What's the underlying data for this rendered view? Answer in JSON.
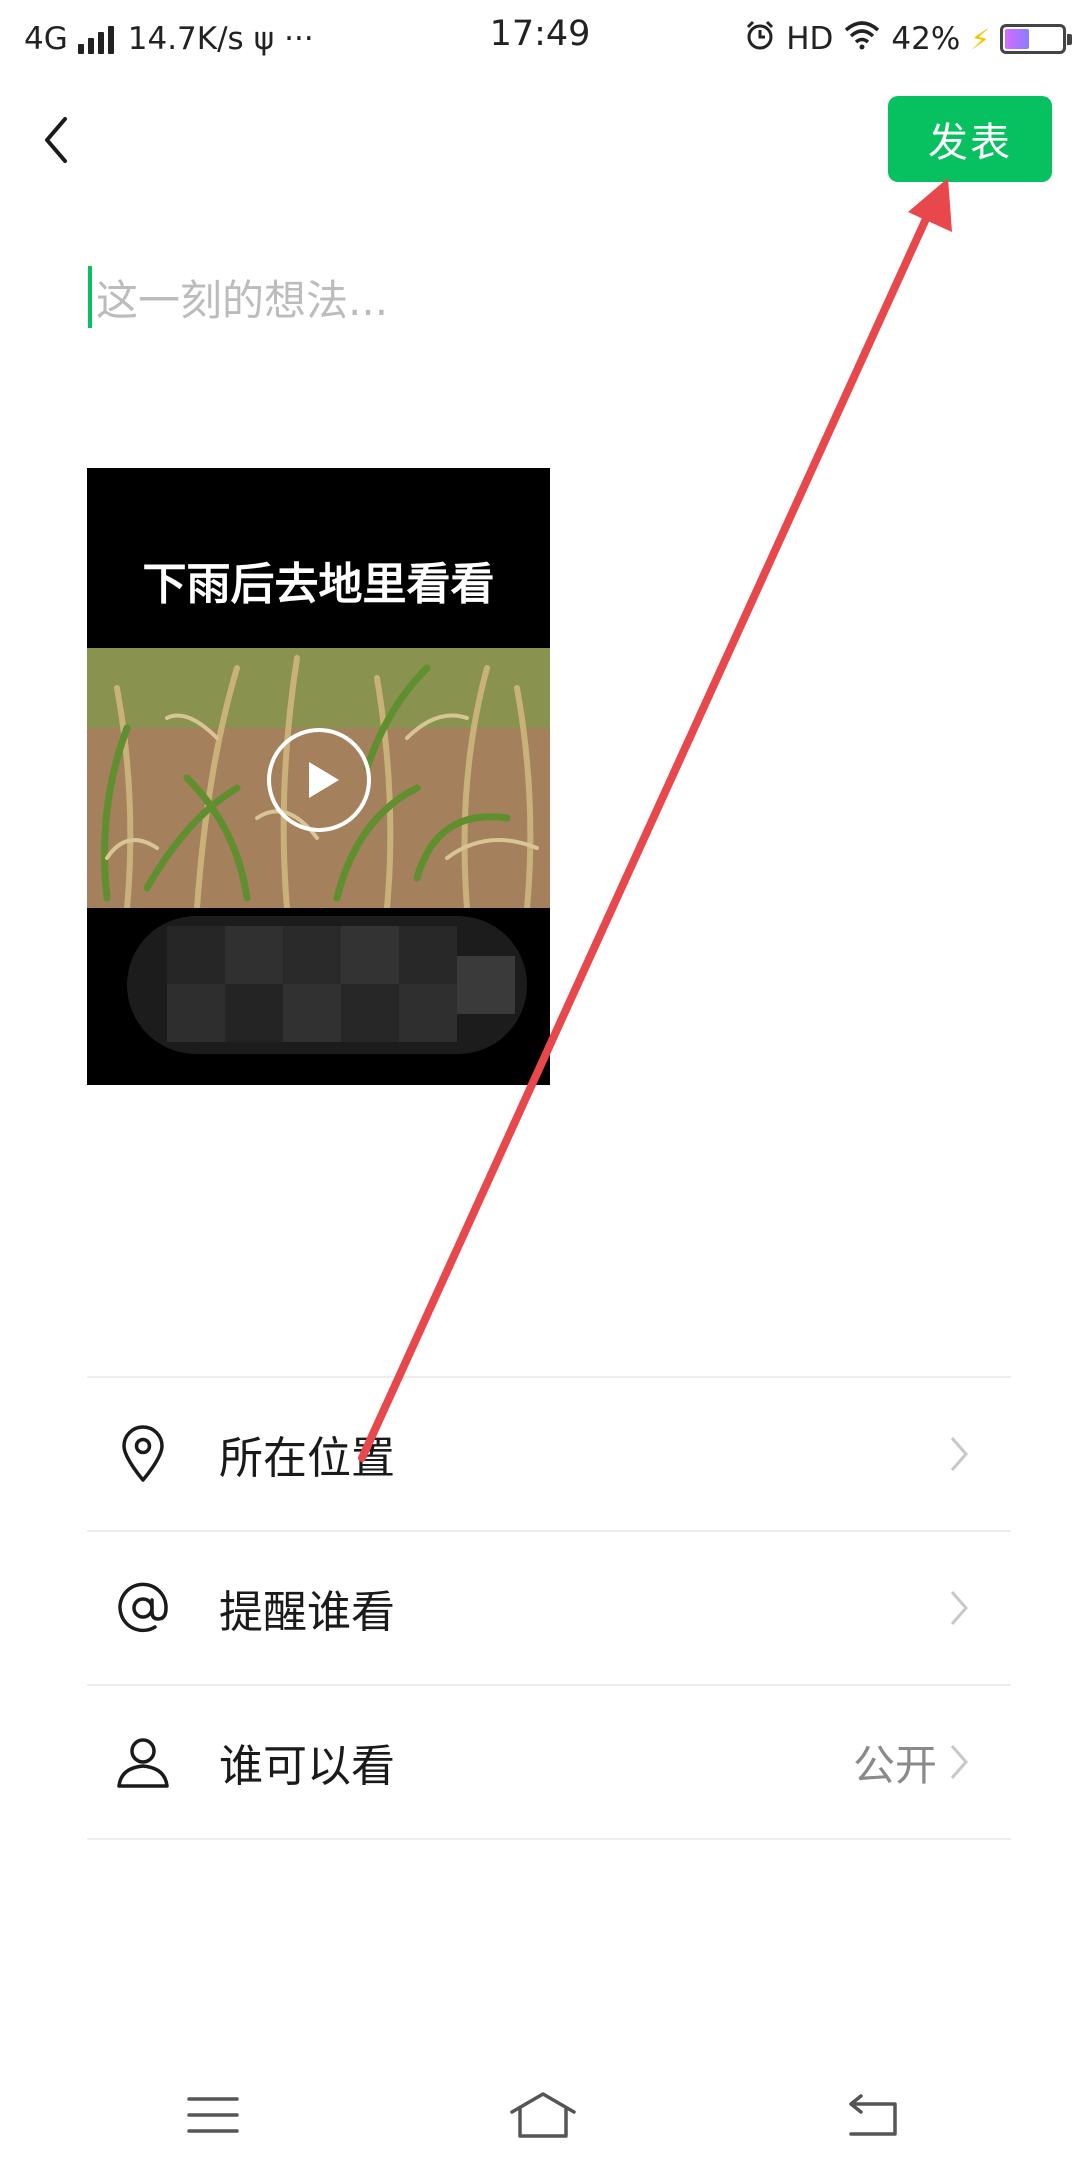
{
  "status_bar": {
    "network": "4G",
    "speed": "14.7K/s",
    "usb_symbol": "ψ",
    "more": "···",
    "time": "17:49",
    "hd": "HD",
    "battery": "42%",
    "battery_level": 0.42,
    "icons": [
      "signal-icon",
      "usb-icon",
      "alarm-icon",
      "wifi-icon",
      "charging-icon",
      "battery-icon"
    ]
  },
  "header": {
    "back_icon": "chevron-left-icon",
    "publish_label": "发表",
    "accent_color": "#07c160"
  },
  "compose": {
    "placeholder": "这一刻的想法..."
  },
  "video": {
    "caption": "下雨后去地里看看",
    "play_icon": "play-icon"
  },
  "options": [
    {
      "label": "所在位置",
      "value": "",
      "icon": "location-pin-icon"
    },
    {
      "label": "提醒谁看",
      "value": "",
      "icon": "at-icon"
    },
    {
      "label": "谁可以看",
      "value": "公开",
      "icon": "person-icon"
    }
  ],
  "nav_bar": {
    "icons": [
      "menu-icon",
      "home-icon",
      "back-icon"
    ]
  },
  "annotation": {
    "type": "red-arrow",
    "color": "#e8474c"
  }
}
